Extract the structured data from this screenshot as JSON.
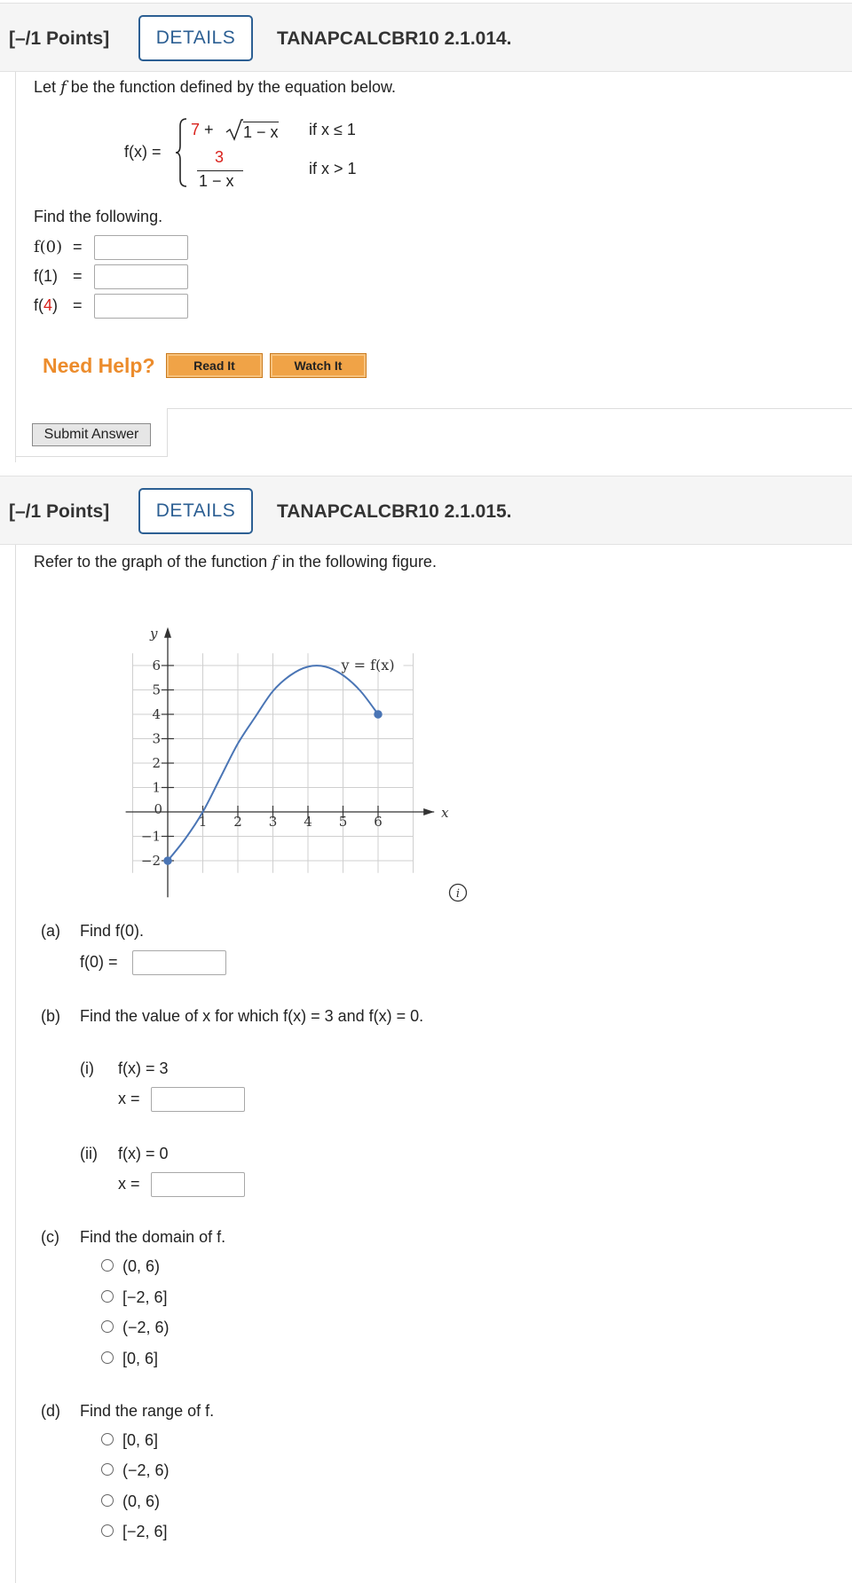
{
  "q1": {
    "points": "[–/1 Points]",
    "details": "DETAILS",
    "id": "TANAPCALCBR10 2.1.014.",
    "intro_a": "Let ",
    "intro_f": "f",
    "intro_b": " be the function defined by the equation below.",
    "fx_label": "f(x)  =",
    "piece1_const": "7",
    "piece1_rest": " + ",
    "piece1_rad": "1 − x",
    "piece1_cond": "if x ≤ 1",
    "piece2_num": "3",
    "piece2_den": "1 − x",
    "piece2_cond": "if x > 1",
    "find": "Find the following.",
    "f0": "f(0)",
    "f1": "f(1)",
    "f4_pre": "f(",
    "f4_arg": "4",
    "f4_post": ")",
    "eq": "=",
    "need_help": "Need Help?",
    "read_it": "Read It",
    "watch_it": "Watch It",
    "submit": "Submit Answer"
  },
  "q2": {
    "points": "[–/1 Points]",
    "details": "DETAILS",
    "id": "TANAPCALCBR10 2.1.015.",
    "intro_a": "Refer to the graph of the function ",
    "intro_f": "f",
    "intro_b": " in the following figure.",
    "a_label": "(a)",
    "a_text": "Find f(0).",
    "a_field": "f(0) =",
    "b_label": "(b)",
    "b_text": "Find the value of x for which f(x) = 3 and f(x) = 0.",
    "bi_label": "(i)",
    "bi_text": "f(x) = 3",
    "bi_field": "x =",
    "bii_label": "(ii)",
    "bii_text": "f(x) = 0",
    "bii_field": "x =",
    "c_label": "(c)",
    "c_text": "Find the domain of f.",
    "c_options": [
      "(0, 6)",
      "[−2, 6]",
      "(−2, 6)",
      "[0, 6]"
    ],
    "d_label": "(d)",
    "d_text": "Find the range of f.",
    "d_options": [
      "[0, 6]",
      "(−2, 6)",
      "(0, 6)",
      "[−2, 6]"
    ]
  },
  "chart_data": {
    "type": "line",
    "xlabel": "x",
    "ylabel": "y",
    "curve_label": "y = f(x)",
    "x_ticks": [
      "1",
      "2",
      "3",
      "4",
      "5",
      "6"
    ],
    "y_ticks": [
      "6",
      "5",
      "4",
      "3",
      "2",
      "1",
      "−1",
      "−2"
    ],
    "origin_label": "0",
    "xlim": [
      -1,
      7
    ],
    "ylim": [
      -3,
      7
    ],
    "grid": true,
    "series": [
      {
        "x": [
          0,
          0.5,
          1,
          1.5,
          2,
          2.5,
          3,
          3.5,
          4,
          4.5,
          5,
          5.5,
          6
        ],
        "y": [
          -2,
          -1.1,
          0,
          1.4,
          2.8,
          3.9,
          4.95,
          5.6,
          5.95,
          5.95,
          5.6,
          4.95,
          4
        ]
      }
    ],
    "endpoints": [
      {
        "x": 0,
        "y": -2,
        "closed": true
      },
      {
        "x": 6,
        "y": 4,
        "closed": true
      }
    ],
    "color": "#4a75b5"
  }
}
